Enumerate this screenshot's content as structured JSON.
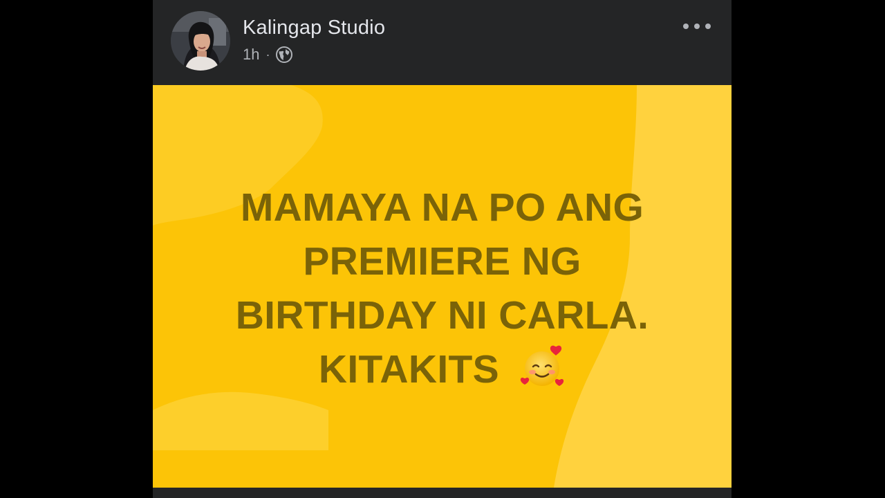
{
  "post": {
    "author": "Kalingap Studio",
    "timestamp": "1h",
    "separator": "·",
    "privacy_icon": "globe-icon",
    "menu_icon": "more-options-icon",
    "lines": [
      "MAMAYA NA PO ANG",
      "PREMIERE NG",
      "BIRTHDAY NI CARLA.",
      "KITAKITS"
    ],
    "emoji": "smiling-face-with-hearts-icon",
    "background_color": "#fcc407",
    "text_color": "#7a6308"
  }
}
